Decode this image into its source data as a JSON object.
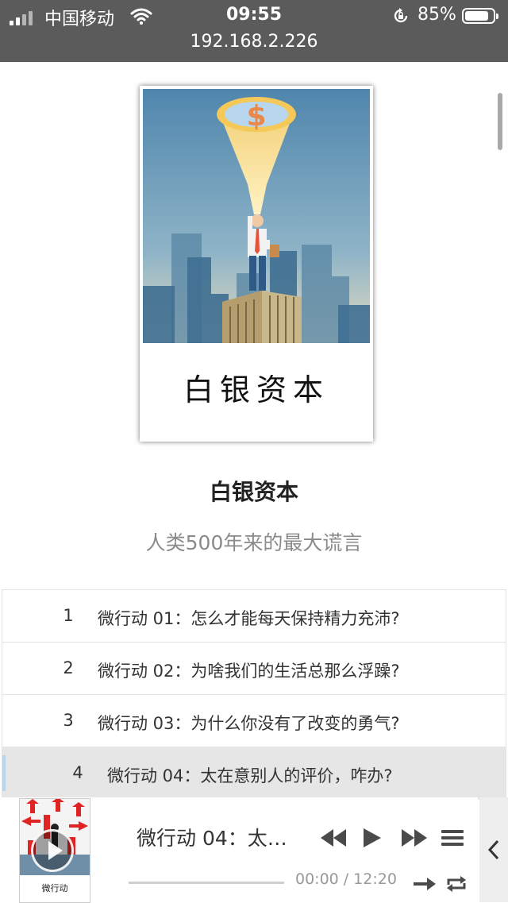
{
  "status_bar": {
    "carrier": "中国移动",
    "time": "09:55",
    "battery": "85%",
    "battery_level": 0.85,
    "url": "192.168.2.226"
  },
  "book": {
    "cover_title": "白银资本",
    "title": "白银资本",
    "subtitle": "人类500年来的最大谎言"
  },
  "episodes": [
    {
      "num": "1",
      "title": "微行动 01：怎么才能每天保持精力充沛?"
    },
    {
      "num": "2",
      "title": "微行动 02：为啥我们的生活总那么浮躁?"
    },
    {
      "num": "3",
      "title": "微行动 03：为什么你没有了改变的勇气?"
    },
    {
      "num": "4",
      "title": "微行动 04：太在意别人的评价，咋办?"
    }
  ],
  "player": {
    "now_playing": "微行动 04：太在意别人的评价，咋办?",
    "thumb_label": "微行动",
    "current_time": "00:00",
    "separator": "/",
    "duration": "12:20",
    "progress": 0
  },
  "colors": {
    "status_bar_bg": "#5b5b5b",
    "active_row_bg": "#e6e6e6",
    "active_indicator": "#b7d6ee",
    "control_icon": "#4a4a4a"
  },
  "icons": [
    "signal-icon",
    "wifi-icon",
    "orientation-lock-icon",
    "battery-icon",
    "rewind-icon",
    "play-icon",
    "fast-forward-icon",
    "playlist-icon",
    "next-icon",
    "repeat-icon",
    "chevron-left-icon"
  ]
}
